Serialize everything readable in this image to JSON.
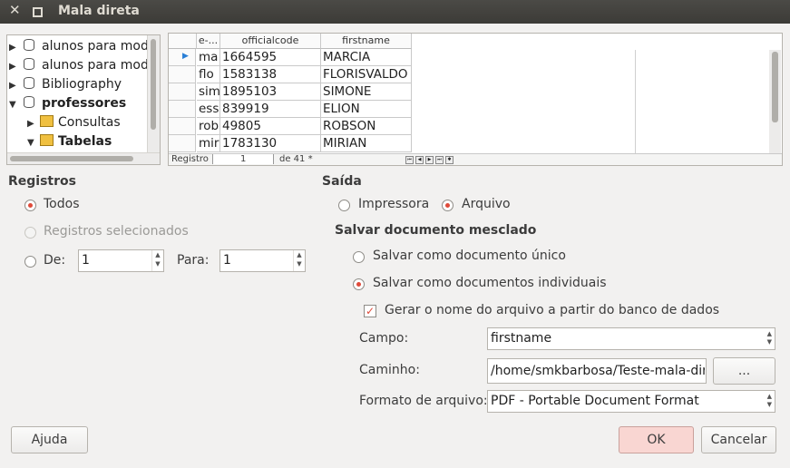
{
  "window": {
    "title": "Mala direta"
  },
  "tree": {
    "items": [
      {
        "label": "alunos para mod",
        "bold": false
      },
      {
        "label": "alunos para mod",
        "bold": false
      },
      {
        "label": "Bibliography",
        "bold": false
      },
      {
        "label": "professores",
        "bold": true
      },
      {
        "label": "Consultas",
        "bold": false
      },
      {
        "label": "Tabelas",
        "bold": true
      }
    ]
  },
  "grid": {
    "headers": [
      "e-...",
      "officialcode",
      "firstname"
    ],
    "rows": [
      [
        "ma",
        "1664595",
        "MARCIA"
      ],
      [
        "flo",
        "1583138",
        "FLORISVALDO"
      ],
      [
        "sim",
        "1895103",
        "SIMONE"
      ],
      [
        "ess",
        "839919",
        "ELION"
      ],
      [
        "rob",
        "49805",
        "ROBSON"
      ],
      [
        "mir",
        "1783130",
        "MIRIAN"
      ]
    ],
    "nav": {
      "label": "Registro",
      "current": "1",
      "total": "de  41 *"
    }
  },
  "registros": {
    "title": "Registros",
    "todos": "Todos",
    "selecionados": "Registros selecionados",
    "de": "De:",
    "de_value": "1",
    "para": "Para:",
    "para_value": "1"
  },
  "saida": {
    "title": "Saída",
    "impressora": "Impressora",
    "arquivo": "Arquivo",
    "salvar_title": "Salvar documento mesclado",
    "unico": "Salvar como documento único",
    "individuais": "Salvar como documentos individuais",
    "gerar": "Gerar o nome do arquivo a partir do banco de dados",
    "campo_label": "Campo:",
    "campo_value": "firstname",
    "caminho_label": "Caminho:",
    "caminho_value": "/home/smkbarbosa/Teste-mala-direta",
    "browse": "...",
    "formato_label": "Formato de arquivo:",
    "formato_value": "PDF - Portable Document Format"
  },
  "buttons": {
    "ajuda": "Ajuda",
    "ok": "OK",
    "cancelar": "Cancelar"
  },
  "colors": {
    "accent": "#df4a3a",
    "ok_bg": "#f9d6d2"
  }
}
